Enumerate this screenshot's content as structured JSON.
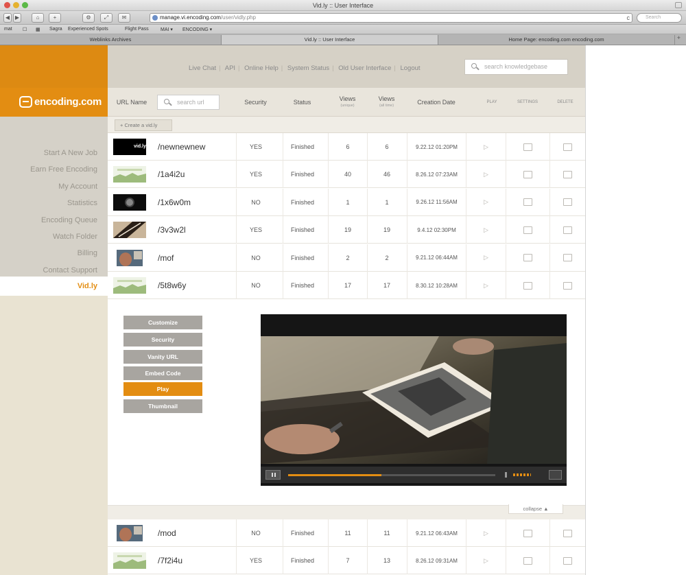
{
  "browser": {
    "window_title": "Vid.ly :: User Interface",
    "url_host": "manage.vi.encoding.com",
    "url_path": "/user/vidly.php",
    "search_placeholder": "Search",
    "toolbar_buttons": [
      "◀",
      "▶",
      "⌂",
      "+",
      "⚙",
      "⤢",
      "✉"
    ],
    "bookmarks": [
      "mat",
      "☐",
      "▦",
      "Sagra",
      "Experienced Spots",
      "Flight Pass",
      "MAI ▾",
      "ENCODING ▾"
    ],
    "tabs": [
      {
        "label": "Weblinks Archives",
        "active": false
      },
      {
        "label": "Vid.ly :: User Interface",
        "active": true
      },
      {
        "label": "Home Page: encoding.com encoding.com",
        "active": false
      }
    ]
  },
  "brand": {
    "name": "encoding.com",
    "accent": "#e38d12"
  },
  "sidebar": {
    "items": [
      "Start A New Job",
      "Earn Free Encoding",
      "My Account",
      "Statistics",
      "Encoding Queue",
      "Watch Folder",
      "Billing",
      "Contact Support"
    ],
    "active": "Vid.ly"
  },
  "topnav": {
    "links": [
      "Live Chat",
      "API",
      "Online Help",
      "System Status",
      "Old User Interface",
      "Logout"
    ],
    "search_placeholder": "search knowledgebase"
  },
  "table": {
    "headers": {
      "url_name": "URL Name",
      "url_search_placeholder": "search url",
      "security": "Security",
      "status": "Status",
      "views_unique": "Views",
      "views_unique_sub": "(unique)",
      "views_all": "Views",
      "views_all_sub": "(all time)",
      "creation_date": "Creation Date",
      "play": "PLAY",
      "settings": "SETTINGS",
      "delete": "DELETE"
    },
    "create_button": "+ Create a vid.ly",
    "rows": [
      {
        "url": "/newnewnew",
        "security": "YES",
        "status": "Finished",
        "unique": "6",
        "all": "6",
        "date": "9.22.12 01:20PM",
        "thumb": "vidly"
      },
      {
        "url": "/1a4i2u",
        "security": "YES",
        "status": "Finished",
        "unique": "40",
        "all": "46",
        "date": "8.26.12 07:23AM",
        "thumb": "green"
      },
      {
        "url": "/1x6w0m",
        "security": "NO",
        "status": "Finished",
        "unique": "1",
        "all": "1",
        "date": "9.26.12 11:56AM",
        "thumb": "globe"
      },
      {
        "url": "/3v3w2l",
        "security": "YES",
        "status": "Finished",
        "unique": "19",
        "all": "19",
        "date": "9.4.12 02:30PM",
        "thumb": "slash"
      },
      {
        "url": "/mof",
        "security": "NO",
        "status": "Finished",
        "unique": "2",
        "all": "2",
        "date": "9.21.12 06:44AM",
        "thumb": "face"
      },
      {
        "url": "/5t8w6y",
        "security": "NO",
        "status": "Finished",
        "unique": "17",
        "all": "17",
        "date": "8.30.12 10:28AM",
        "thumb": "green"
      }
    ],
    "rows_after": [
      {
        "url": "/mod",
        "security": "NO",
        "status": "Finished",
        "unique": "11",
        "all": "11",
        "date": "9.21.12 06:43AM",
        "thumb": "face"
      },
      {
        "url": "/7f2i4u",
        "security": "YES",
        "status": "Finished",
        "unique": "7",
        "all": "13",
        "date": "8.26.12 09:31AM",
        "thumb": "green"
      }
    ]
  },
  "panel": {
    "buttons": [
      {
        "label": "Customize",
        "active": false
      },
      {
        "label": "Security",
        "active": false
      },
      {
        "label": "Vanity URL",
        "active": false
      },
      {
        "label": "Embed Code",
        "active": false
      },
      {
        "label": "Play",
        "active": true
      },
      {
        "label": "Thumbnail",
        "active": false
      }
    ],
    "player": {
      "progress": 0.45,
      "volume": 0.8
    },
    "collapse_label": "collapse ▲"
  }
}
